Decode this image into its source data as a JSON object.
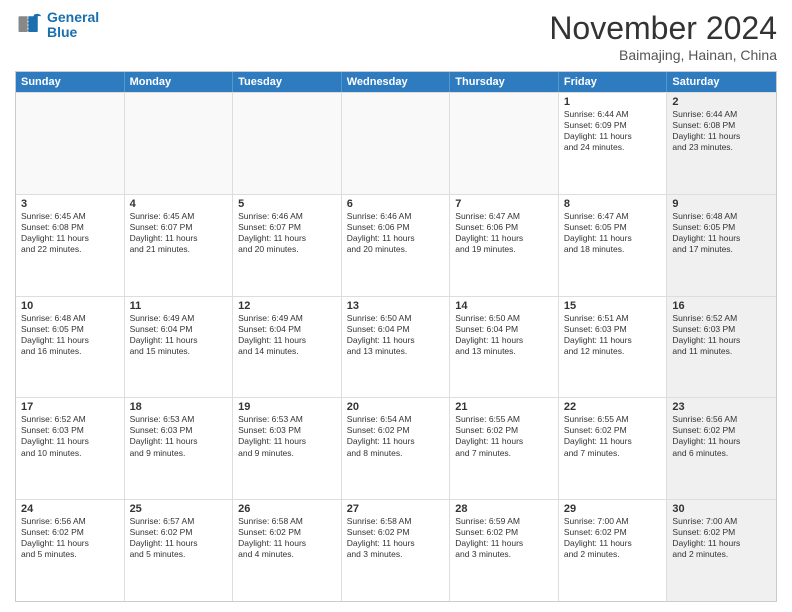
{
  "logo": {
    "line1": "General",
    "line2": "Blue"
  },
  "title": "November 2024",
  "subtitle": "Baimajing, Hainan, China",
  "header_days": [
    "Sunday",
    "Monday",
    "Tuesday",
    "Wednesday",
    "Thursday",
    "Friday",
    "Saturday"
  ],
  "rows": [
    [
      {
        "day": "",
        "info": "",
        "empty": true
      },
      {
        "day": "",
        "info": "",
        "empty": true
      },
      {
        "day": "",
        "info": "",
        "empty": true
      },
      {
        "day": "",
        "info": "",
        "empty": true
      },
      {
        "day": "",
        "info": "",
        "empty": true
      },
      {
        "day": "1",
        "info": "Sunrise: 6:44 AM\nSunset: 6:09 PM\nDaylight: 11 hours\nand 24 minutes.",
        "empty": false
      },
      {
        "day": "2",
        "info": "Sunrise: 6:44 AM\nSunset: 6:08 PM\nDaylight: 11 hours\nand 23 minutes.",
        "empty": false,
        "shaded": true
      }
    ],
    [
      {
        "day": "3",
        "info": "Sunrise: 6:45 AM\nSunset: 6:08 PM\nDaylight: 11 hours\nand 22 minutes.",
        "empty": false
      },
      {
        "day": "4",
        "info": "Sunrise: 6:45 AM\nSunset: 6:07 PM\nDaylight: 11 hours\nand 21 minutes.",
        "empty": false
      },
      {
        "day": "5",
        "info": "Sunrise: 6:46 AM\nSunset: 6:07 PM\nDaylight: 11 hours\nand 20 minutes.",
        "empty": false
      },
      {
        "day": "6",
        "info": "Sunrise: 6:46 AM\nSunset: 6:06 PM\nDaylight: 11 hours\nand 20 minutes.",
        "empty": false
      },
      {
        "day": "7",
        "info": "Sunrise: 6:47 AM\nSunset: 6:06 PM\nDaylight: 11 hours\nand 19 minutes.",
        "empty": false
      },
      {
        "day": "8",
        "info": "Sunrise: 6:47 AM\nSunset: 6:05 PM\nDaylight: 11 hours\nand 18 minutes.",
        "empty": false
      },
      {
        "day": "9",
        "info": "Sunrise: 6:48 AM\nSunset: 6:05 PM\nDaylight: 11 hours\nand 17 minutes.",
        "empty": false,
        "shaded": true
      }
    ],
    [
      {
        "day": "10",
        "info": "Sunrise: 6:48 AM\nSunset: 6:05 PM\nDaylight: 11 hours\nand 16 minutes.",
        "empty": false
      },
      {
        "day": "11",
        "info": "Sunrise: 6:49 AM\nSunset: 6:04 PM\nDaylight: 11 hours\nand 15 minutes.",
        "empty": false
      },
      {
        "day": "12",
        "info": "Sunrise: 6:49 AM\nSunset: 6:04 PM\nDaylight: 11 hours\nand 14 minutes.",
        "empty": false
      },
      {
        "day": "13",
        "info": "Sunrise: 6:50 AM\nSunset: 6:04 PM\nDaylight: 11 hours\nand 13 minutes.",
        "empty": false
      },
      {
        "day": "14",
        "info": "Sunrise: 6:50 AM\nSunset: 6:04 PM\nDaylight: 11 hours\nand 13 minutes.",
        "empty": false
      },
      {
        "day": "15",
        "info": "Sunrise: 6:51 AM\nSunset: 6:03 PM\nDaylight: 11 hours\nand 12 minutes.",
        "empty": false
      },
      {
        "day": "16",
        "info": "Sunrise: 6:52 AM\nSunset: 6:03 PM\nDaylight: 11 hours\nand 11 minutes.",
        "empty": false,
        "shaded": true
      }
    ],
    [
      {
        "day": "17",
        "info": "Sunrise: 6:52 AM\nSunset: 6:03 PM\nDaylight: 11 hours\nand 10 minutes.",
        "empty": false
      },
      {
        "day": "18",
        "info": "Sunrise: 6:53 AM\nSunset: 6:03 PM\nDaylight: 11 hours\nand 9 minutes.",
        "empty": false
      },
      {
        "day": "19",
        "info": "Sunrise: 6:53 AM\nSunset: 6:03 PM\nDaylight: 11 hours\nand 9 minutes.",
        "empty": false
      },
      {
        "day": "20",
        "info": "Sunrise: 6:54 AM\nSunset: 6:02 PM\nDaylight: 11 hours\nand 8 minutes.",
        "empty": false
      },
      {
        "day": "21",
        "info": "Sunrise: 6:55 AM\nSunset: 6:02 PM\nDaylight: 11 hours\nand 7 minutes.",
        "empty": false
      },
      {
        "day": "22",
        "info": "Sunrise: 6:55 AM\nSunset: 6:02 PM\nDaylight: 11 hours\nand 7 minutes.",
        "empty": false
      },
      {
        "day": "23",
        "info": "Sunrise: 6:56 AM\nSunset: 6:02 PM\nDaylight: 11 hours\nand 6 minutes.",
        "empty": false,
        "shaded": true
      }
    ],
    [
      {
        "day": "24",
        "info": "Sunrise: 6:56 AM\nSunset: 6:02 PM\nDaylight: 11 hours\nand 5 minutes.",
        "empty": false
      },
      {
        "day": "25",
        "info": "Sunrise: 6:57 AM\nSunset: 6:02 PM\nDaylight: 11 hours\nand 5 minutes.",
        "empty": false
      },
      {
        "day": "26",
        "info": "Sunrise: 6:58 AM\nSunset: 6:02 PM\nDaylight: 11 hours\nand 4 minutes.",
        "empty": false
      },
      {
        "day": "27",
        "info": "Sunrise: 6:58 AM\nSunset: 6:02 PM\nDaylight: 11 hours\nand 3 minutes.",
        "empty": false
      },
      {
        "day": "28",
        "info": "Sunrise: 6:59 AM\nSunset: 6:02 PM\nDaylight: 11 hours\nand 3 minutes.",
        "empty": false
      },
      {
        "day": "29",
        "info": "Sunrise: 7:00 AM\nSunset: 6:02 PM\nDaylight: 11 hours\nand 2 minutes.",
        "empty": false
      },
      {
        "day": "30",
        "info": "Sunrise: 7:00 AM\nSunset: 6:02 PM\nDaylight: 11 hours\nand 2 minutes.",
        "empty": false,
        "shaded": true
      }
    ]
  ]
}
